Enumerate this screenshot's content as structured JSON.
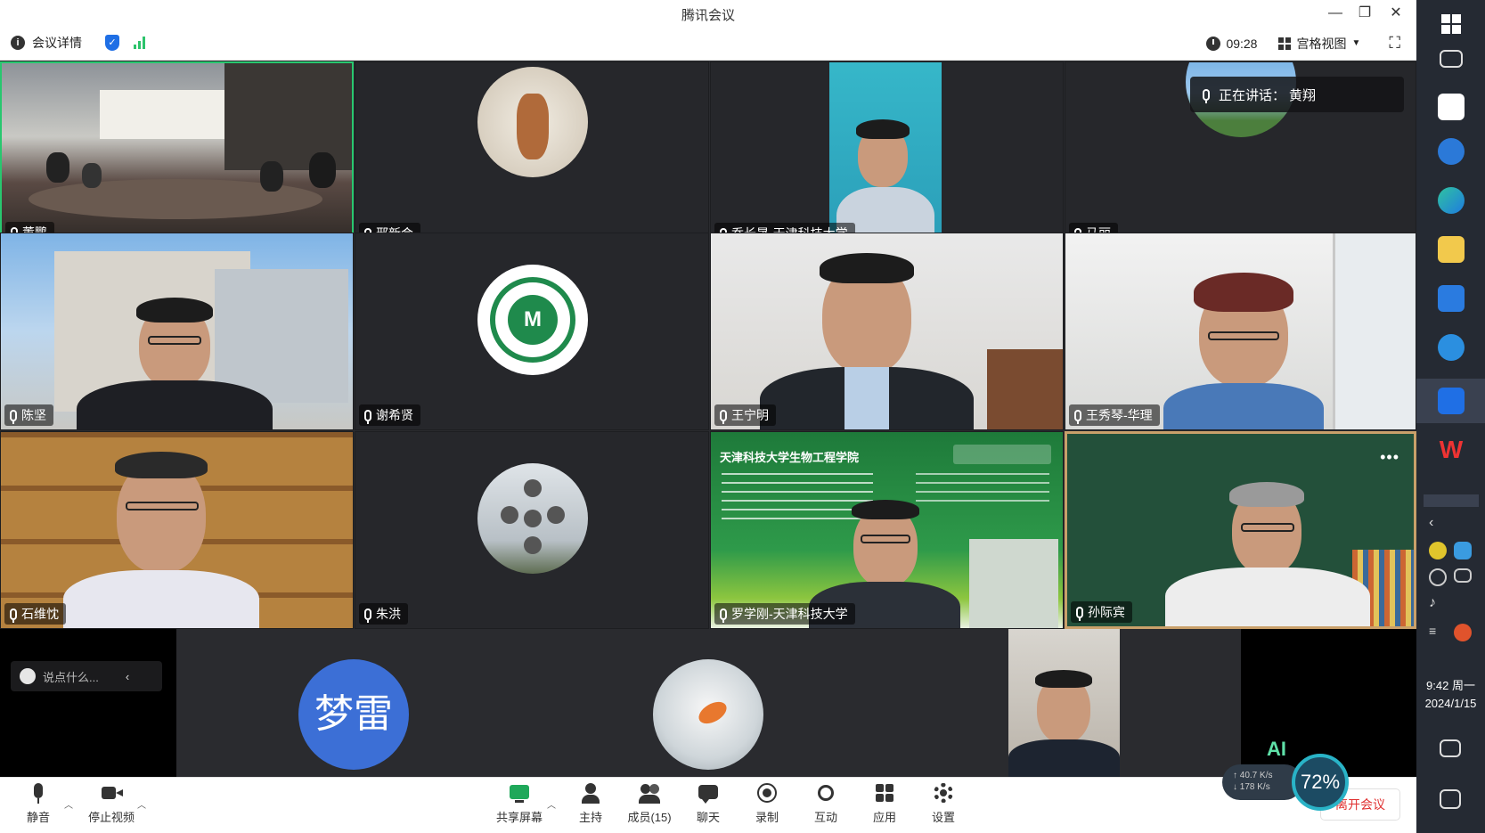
{
  "window": {
    "title": "腾讯会议",
    "minimize_glyph": "—",
    "restore_glyph": "❐",
    "close_glyph": "✕"
  },
  "infobar": {
    "meeting_details_label": "会议详情",
    "duration": "09:28",
    "view_label": "宫格视图",
    "fullscreen_glyph": "⛶"
  },
  "speaking": {
    "label": "正在讲话：",
    "name": "黄翔"
  },
  "participants": [
    {
      "name": "董鹏"
    },
    {
      "name": "邢新会"
    },
    {
      "name": "乔长晟-天津科技大学"
    },
    {
      "name": "马丽"
    },
    {
      "name": "陈坚"
    },
    {
      "name": "谢希贤"
    },
    {
      "name": "王宁明"
    },
    {
      "name": "王秀琴-华理"
    },
    {
      "name": "石维忱"
    },
    {
      "name": "朱洪"
    },
    {
      "name": "罗学刚-天津科技大学"
    },
    {
      "name": "孙际宾"
    }
  ],
  "slide": {
    "title": "天津科技大学生物工程学院"
  },
  "strip": {
    "chat_preview": "说点什么...",
    "initial_avatar_text": "梦雷"
  },
  "toolbar": {
    "mute": "静音",
    "stop_video": "停止视频",
    "share_screen": "共享屏幕",
    "host": "主持",
    "members": "成员(15)",
    "chat": "聊天",
    "record": "录制",
    "interact": "互动",
    "apps": "应用",
    "settings": "设置",
    "leave": "离开会议"
  },
  "network": {
    "ai_label": "AI",
    "upload_speed": "40.7 K/s",
    "download_speed": "178 K/s",
    "cpu_percent": "72%"
  },
  "taskbar": {
    "time": "9:42 周一",
    "date": "2024/1/15"
  },
  "colors": {
    "active_speaker_border": "#28c76f",
    "avatar_blue": "#3c6fd6",
    "leave_red": "#e03131"
  }
}
